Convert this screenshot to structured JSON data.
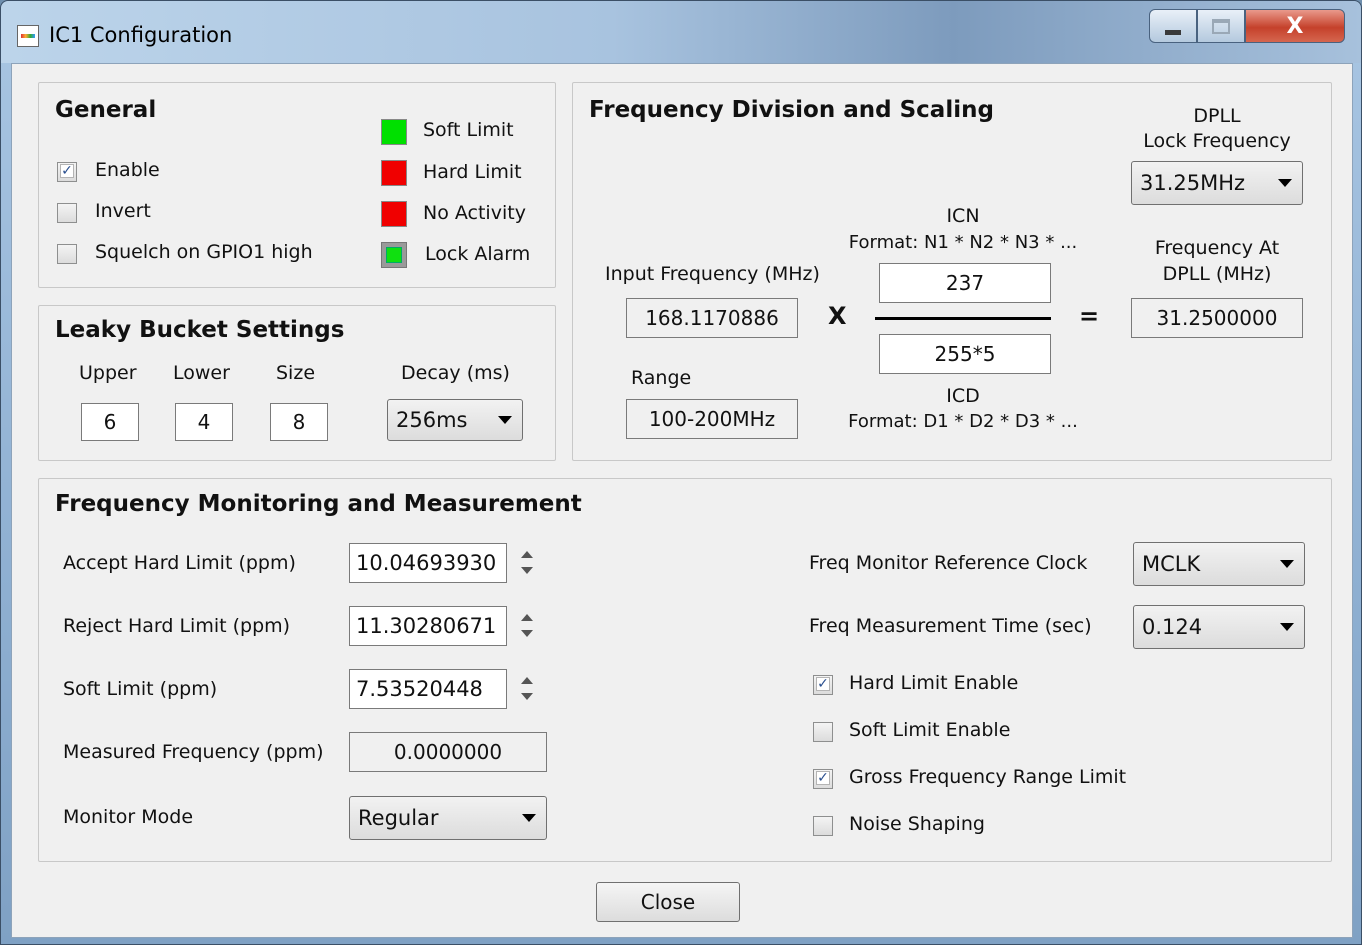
{
  "window": {
    "title": "IC1 Configuration",
    "close_glyph": "X"
  },
  "general": {
    "title": "General",
    "checkboxes": [
      {
        "label": "Enable",
        "checked": true
      },
      {
        "label": "Invert",
        "checked": false
      },
      {
        "label": "Squelch on GPIO1 high",
        "checked": false
      }
    ],
    "indicators": [
      {
        "label": "Soft Limit",
        "color": "#00e000"
      },
      {
        "label": "Hard Limit",
        "color": "#f00000"
      },
      {
        "label": "No Activity",
        "color": "#f00000"
      },
      {
        "label": "Lock Alarm",
        "color": "#10e010"
      }
    ]
  },
  "leaky_bucket": {
    "title": "Leaky Bucket Settings",
    "upper_label": "Upper",
    "upper_value": "6",
    "lower_label": "Lower",
    "lower_value": "4",
    "size_label": "Size",
    "size_value": "8",
    "decay_label": "Decay (ms)",
    "decay_value": "256ms"
  },
  "freq_div": {
    "title": "Frequency Division and Scaling",
    "dpll_label_1": "DPLL",
    "dpll_label_2": "Lock Frequency",
    "dpll_lock_value": "31.25MHz",
    "input_freq_label": "Input Frequency (MHz)",
    "input_freq_value": "168.1170886",
    "multiply": "X",
    "icn_label": "ICN",
    "icn_format": "Format: N1 * N2 * N3 * ...",
    "icn_value": "237",
    "icd_value": "255*5",
    "icd_label": "ICD",
    "icd_format": "Format: D1 * D2 * D3 * ...",
    "equals": "=",
    "freq_at_dpll_label_1": "Frequency At",
    "freq_at_dpll_label_2": "DPLL (MHz)",
    "freq_at_dpll_value": "31.2500000",
    "range_label": "Range",
    "range_value": "100-200MHz"
  },
  "monitoring": {
    "title": "Frequency Monitoring and Measurement",
    "accept_label": "Accept Hard Limit (ppm)",
    "accept_value": "10.04693930",
    "reject_label": "Reject Hard Limit (ppm)",
    "reject_value": "11.30280671",
    "soft_label": "Soft Limit (ppm)",
    "soft_value": "7.53520448",
    "measured_label": "Measured Frequency (ppm)",
    "measured_value": "0.0000000",
    "mode_label": "Monitor Mode",
    "mode_value": "Regular",
    "ref_clock_label": "Freq Monitor Reference Clock",
    "ref_clock_value": "MCLK",
    "meas_time_label": "Freq Measurement Time (sec)",
    "meas_time_value": "0.124",
    "checkboxes": [
      {
        "label": "Hard Limit Enable",
        "checked": true
      },
      {
        "label": "Soft Limit Enable",
        "checked": false
      },
      {
        "label": "Gross Frequency Range Limit",
        "checked": true
      },
      {
        "label": "Noise Shaping",
        "checked": false
      }
    ]
  },
  "close_button_label": "Close"
}
